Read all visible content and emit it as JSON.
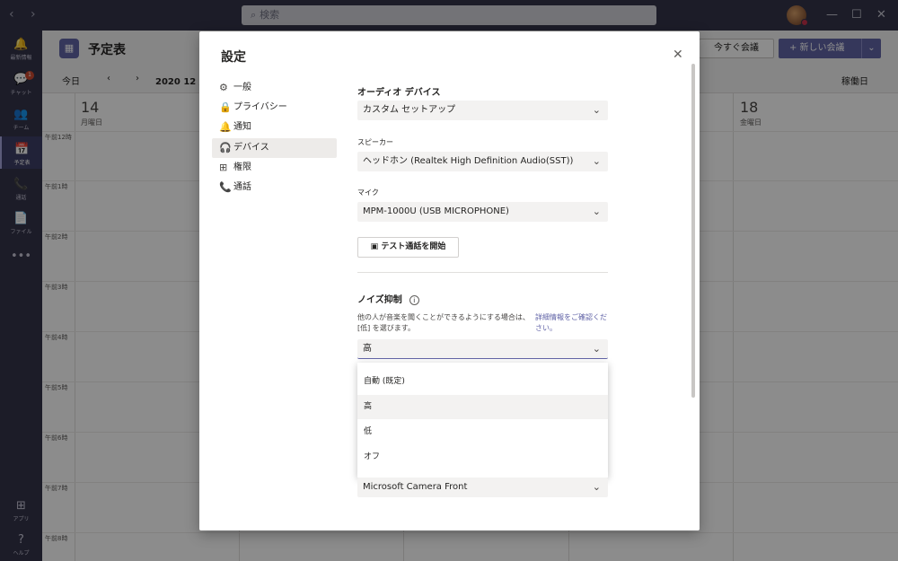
{
  "titlebar": {
    "back": "‹",
    "forward": "›",
    "search_placeholder": "検索",
    "minimize": "—",
    "maximize": "☐",
    "close": "✕"
  },
  "rail": {
    "items": [
      {
        "icon": "🔔",
        "label": "最新情報"
      },
      {
        "icon": "💬",
        "label": "チャット",
        "badge": "1"
      },
      {
        "icon": "👥",
        "label": "チーム"
      },
      {
        "icon": "📅",
        "label": "予定表"
      },
      {
        "icon": "📞",
        "label": "通話"
      },
      {
        "icon": "📄",
        "label": "ファイル"
      },
      {
        "icon": "•••",
        "label": ""
      },
      {
        "icon": "⊞",
        "label": "アプリ"
      },
      {
        "icon": "?",
        "label": "ヘルプ"
      }
    ]
  },
  "calendar": {
    "title": "予定表",
    "meet_now": "今すぐ会議",
    "new_meeting": "+ 新しい会議",
    "today": "今日",
    "month": "2020 12 月",
    "view": "稼働日",
    "days": [
      {
        "num": "14",
        "name": "月曜日"
      },
      {
        "num": "18",
        "name": "金曜日"
      }
    ],
    "hours": [
      "午前12時",
      "午前1時",
      "午前2時",
      "午前3時",
      "午前4時",
      "午前5時",
      "午前6時",
      "午前7時",
      "午前8時"
    ]
  },
  "dialog": {
    "title": "設定",
    "close": "✕",
    "nav": [
      {
        "icon": "⚙",
        "label": "一般"
      },
      {
        "icon": "🔒",
        "label": "プライバシー"
      },
      {
        "icon": "🔔",
        "label": "通知"
      },
      {
        "icon": "🎧",
        "label": "デバイス"
      },
      {
        "icon": "⊞",
        "label": "権限"
      },
      {
        "icon": "📞",
        "label": "通話"
      }
    ],
    "audio_device_label": "オーディオ デバイス",
    "audio_device_value": "カスタム セットアップ",
    "speaker_label": "スピーカー",
    "speaker_value": "ヘッドホン (Realtek High Definition Audio(SST))",
    "mic_label": "マイク",
    "mic_value": "MPM-1000U (USB MICROPHONE)",
    "test_call": "テスト通話を開始",
    "noise_label": "ノイズ抑制",
    "noise_desc": "他の人が音楽を聞くことができるようにする場合は、[低] を選びます。",
    "noise_link": "詳細情報をご確認ください。",
    "noise_value": "高",
    "noise_options": [
      "自動 (既定)",
      "高",
      "低",
      "オフ"
    ],
    "camera_value": "Microsoft Camera Front",
    "chevron": "⌄"
  }
}
